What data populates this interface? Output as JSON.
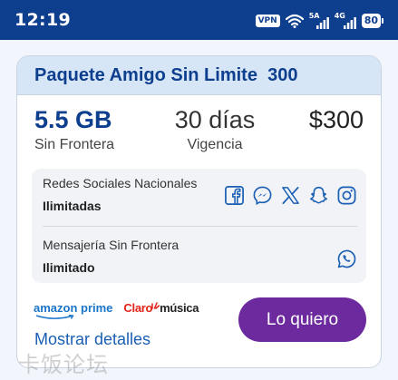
{
  "status_bar": {
    "time": "12:19",
    "vpn": "VPN",
    "net1": "5A",
    "net2": "4G",
    "battery": "80",
    "icons": [
      "vpn-icon",
      "wifi-icon",
      "signal-icon",
      "signal-icon",
      "battery-icon"
    ]
  },
  "plan": {
    "title": "Paquete Amigo Sin Limite  300",
    "data_amount": "5.5 GB",
    "data_label": "Sin Frontera",
    "validity": "30 días",
    "validity_label": "Vigencia",
    "price": "$300"
  },
  "benefits": [
    {
      "label": "Redes Sociales Nacionales",
      "value": "Ilimitadas",
      "icons": [
        "facebook-icon",
        "messenger-icon",
        "x-icon",
        "snapchat-icon",
        "instagram-icon"
      ]
    },
    {
      "label": "Mensajería Sin Frontera",
      "value": "Ilimitado",
      "icons": [
        "whatsapp-icon"
      ]
    }
  ],
  "logos": {
    "amazon": "amazon prime",
    "claro": "Claro",
    "musica": "música"
  },
  "cta_label": "Lo quiero",
  "details_label": "Mostrar detalles",
  "watermark": "卡饭论坛",
  "colors": {
    "header_bar": "#0e3e8e",
    "brand_blue": "#0e3e8e",
    "link_blue": "#1a5fb4",
    "cta_purple": "#6c2a9e",
    "card_header_bg": "#d7e6f7",
    "claro_red": "#e2231a"
  }
}
